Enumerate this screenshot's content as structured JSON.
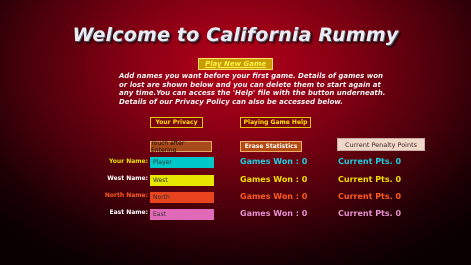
{
  "title": "Welcome to California Rummy",
  "play_button": "Play New Game",
  "info_text": "Add names you want before your first game. Details of games won or lost are shown below and you can delete them to start again at any time.You can access the 'Help' file with the button underneath. Details of our Privacy Policy can also be accessed below.",
  "privacy_button": "Your Privacy",
  "help_button": "Playing Game Help",
  "touch_button": "Touch after Entering",
  "erase_button": "Erase Statistics",
  "penalty_button": "Current Penalty Points",
  "players": [
    {
      "label": "Your Name:",
      "name": "Player",
      "games_won": "Games Won : 0",
      "points": "Current Pts. 0",
      "label_color": "#e6e600",
      "input_color": "#00c8c8",
      "stat_color": "#1ed0e0"
    },
    {
      "label": "West Name:",
      "name": "West",
      "games_won": "Games Won  :  0",
      "points": "Current Pts. 0",
      "label_color": "#ffffff",
      "input_color": "#e6e600",
      "stat_color": "#f0e000"
    },
    {
      "label": "North Name:",
      "name": "North",
      "games_won": "Games Won : 0",
      "points": "Current Pts. 0",
      "label_color": "#ff5a1e",
      "input_color": "#e8441e",
      "stat_color": "#ff5a1e"
    },
    {
      "label": "East Name:",
      "name": "East",
      "games_won": "Games Won : 0",
      "points": "Current Pts. 0",
      "label_color": "#ffffff",
      "input_color": "#e06ab8",
      "stat_color": "#e890d0"
    }
  ]
}
